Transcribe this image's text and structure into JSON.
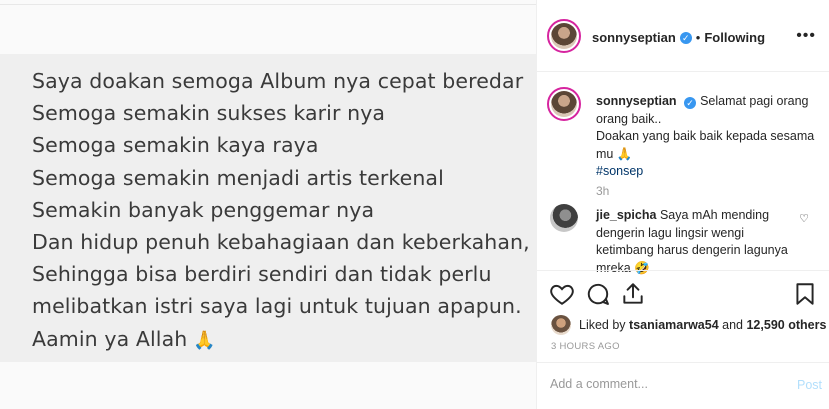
{
  "media": {
    "lines": [
      "Saya doakan semoga Album nya cepat beredar",
      "Semoga semakin sukses karir nya",
      "Semoga semakin kaya raya",
      "Semoga semakin menjadi artis terkenal",
      "Semakin banyak penggemar nya",
      "Dan hidup penuh kebahagiaan dan keberkahan,",
      "Sehingga bisa berdiri sendiri dan tidak perlu",
      "melibatkan istri saya lagi untuk tujuan apapun.",
      "Aamin ya Allah"
    ],
    "last_line_emoji": "🙏"
  },
  "header": {
    "username": "sonnyseptian",
    "separator": "•",
    "follow_status": "Following",
    "more_icon": "•••"
  },
  "caption": {
    "username": "sonnyseptian",
    "text_line1": "Selamat pagi orang orang baik..",
    "text_line2": "Doakan yang baik baik kepada sesama mu 🙏",
    "hashtag": "#sonsep",
    "time": "3h"
  },
  "comment": {
    "username": "jie_spicha",
    "text": "Saya mAh mending dengerin lagu lingsir wengi ketimbang harus dengerin lagunya mreka 🤣"
  },
  "likes": {
    "prefix": "Liked by ",
    "user": "tsaniamarwa54",
    "middle": " and ",
    "others": "12,590 others"
  },
  "time_ago": "3 HOURS AGO",
  "add_comment": {
    "placeholder": "Add a comment...",
    "post_label": "Post"
  },
  "icons": {
    "verified": "verified-badge-icon",
    "heart": "heart-icon",
    "comment": "comment-icon",
    "share": "share-icon",
    "save": "bookmark-icon"
  }
}
